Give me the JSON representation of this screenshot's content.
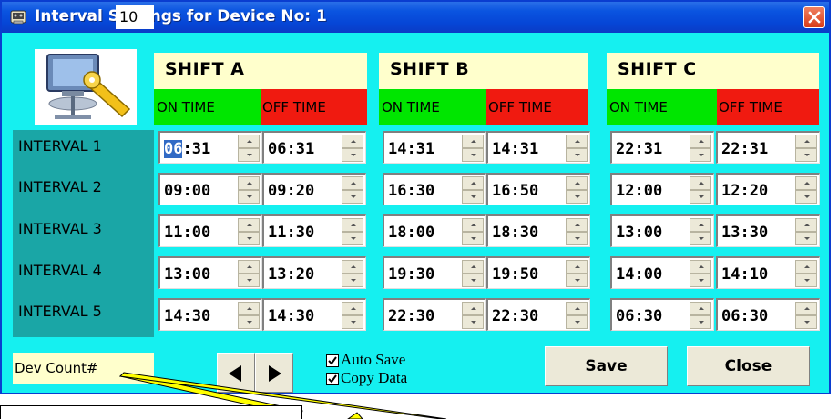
{
  "window": {
    "title": "Interval Settings for Device No: 1",
    "title_icon": "device-settings-icon",
    "close_icon": "close-icon"
  },
  "logo": {
    "icon": "computer-network-settings-icon"
  },
  "shifts": [
    {
      "name": "SHIFT A",
      "on_label": "ON TIME",
      "off_label": "OFF TIME"
    },
    {
      "name": "SHIFT B",
      "on_label": "ON TIME",
      "off_label": "OFF TIME"
    },
    {
      "name": "SHIFT C",
      "on_label": "ON TIME",
      "off_label": "OFF TIME"
    }
  ],
  "intervals": [
    {
      "label": "INTERVAL 1",
      "times": [
        "06:31",
        "06:31",
        "14:31",
        "14:31",
        "22:31",
        "22:31"
      ]
    },
    {
      "label": "INTERVAL 2",
      "times": [
        "09:00",
        "09:20",
        "16:30",
        "16:50",
        "12:00",
        "12:20"
      ]
    },
    {
      "label": "INTERVAL 3",
      "times": [
        "11:00",
        "11:30",
        "18:00",
        "18:30",
        "13:00",
        "13:30"
      ]
    },
    {
      "label": "INTERVAL 4",
      "times": [
        "13:00",
        "13:20",
        "19:30",
        "19:50",
        "14:00",
        "14:10"
      ]
    },
    {
      "label": "INTERVAL 5",
      "times": [
        "14:30",
        "14:30",
        "22:30",
        "22:30",
        "06:30",
        "06:30"
      ]
    }
  ],
  "first_cell": {
    "selected": "06",
    "rest": ":31"
  },
  "device_count": {
    "label": "Dev Count#",
    "value": "10"
  },
  "nav": {
    "prev_icon": "arrow-left-icon",
    "next_icon": "arrow-right-icon"
  },
  "options": {
    "auto_save": {
      "label": "Auto Save",
      "checked": true
    },
    "copy_data": {
      "label": "Copy Data",
      "checked": true
    }
  },
  "buttons": {
    "save": "Save",
    "close": "Close"
  },
  "colors": {
    "window_bg": "#15f0f0",
    "shift_header": "#ffffcc",
    "on_time": "#00e600",
    "off_time": "#f01a10",
    "interval_panel": "#1aa6a6",
    "callout_line": "#ffff00"
  }
}
